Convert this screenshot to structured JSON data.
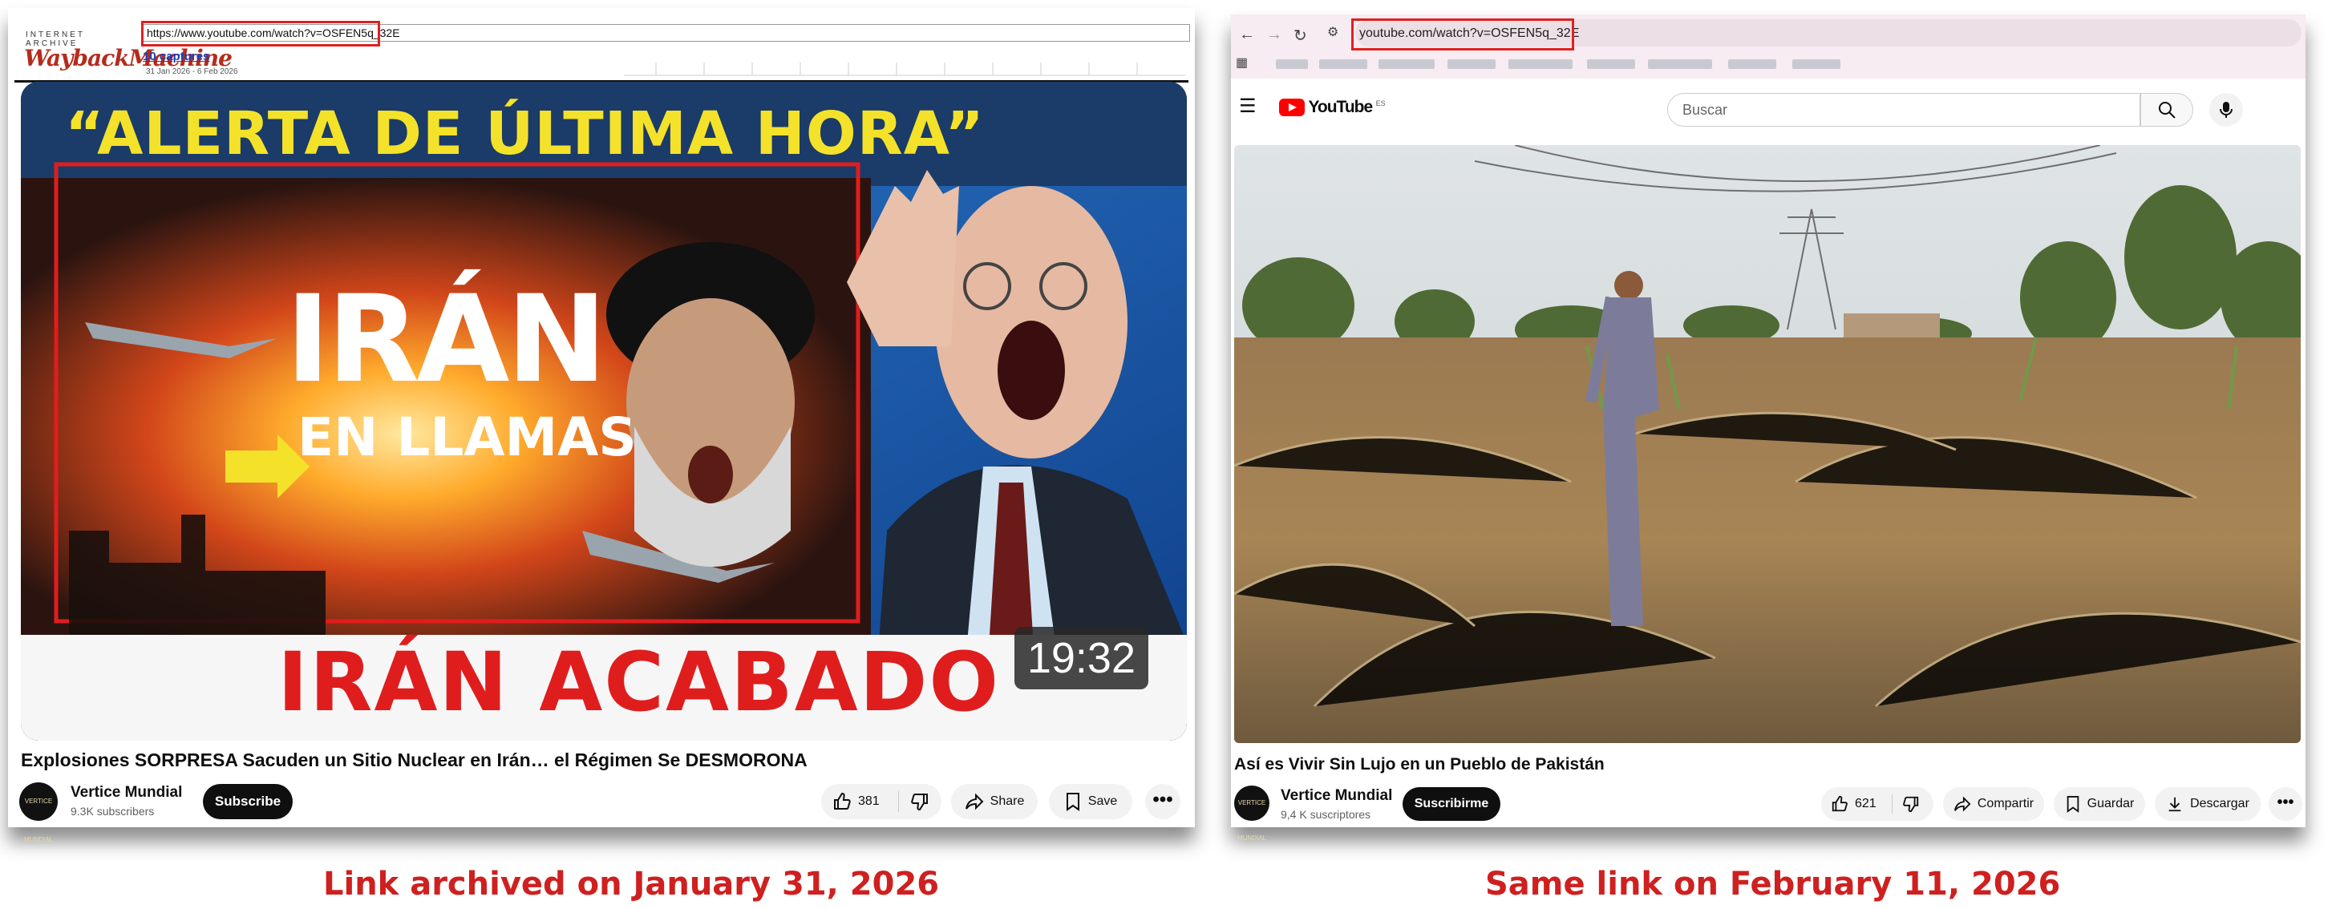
{
  "left": {
    "wayback": {
      "ia_text": "INTERNET ARCHIVE",
      "logo_text": "WaybackMachine",
      "url": "https://www.youtube.com/watch?v=OSFEN5q_32E",
      "captures": "10 captures",
      "date_range": "31 Jan 2026 - 6 Feb 2026"
    },
    "thumbnail": {
      "headline": "“ALERTA DE ÚLTIMA HORA”",
      "word1": "IRÁN",
      "word2": "EN LLAMAS",
      "bottom": "IRÁN ACABADO",
      "duration": "19:32"
    },
    "video_title": "Explosiones SORPRESA Sacuden un Sitio Nuclear en Irán… el Régimen Se DESMORONA",
    "channel": {
      "name": "Vertice Mundial",
      "subscribers": "9.3K subscribers",
      "avatar_text": "VERTICE MUNDIAL",
      "subscribe": "Subscribe"
    },
    "actions": {
      "likes": "381",
      "share": "Share",
      "save": "Save",
      "more": "•••"
    }
  },
  "right": {
    "browser": {
      "url": "youtube.com/watch?v=OSFEN5q_32E"
    },
    "youtube": {
      "logo": "YouTube",
      "country": "ES",
      "search_placeholder": "Buscar"
    },
    "video_title": "Así es Vivir Sin Lujo en un Pueblo de Pakistán",
    "channel": {
      "name": "Vertice Mundial",
      "subscribers": "9,4 K suscriptores",
      "avatar_text": "VERTICE MUNDIAL",
      "subscribe": "Suscribirme"
    },
    "actions": {
      "likes": "621",
      "share": "Compartir",
      "save": "Guardar",
      "download": "Descargar",
      "more": "•••"
    }
  },
  "captions": {
    "left": "Link archived on January 31, 2026",
    "right": "Same link on February 11, 2026"
  },
  "colors": {
    "accent_red": "#cf2020",
    "youtube_red": "#ff0000",
    "wayback_red": "#b52c1c",
    "highlight_box": "#e02020"
  }
}
